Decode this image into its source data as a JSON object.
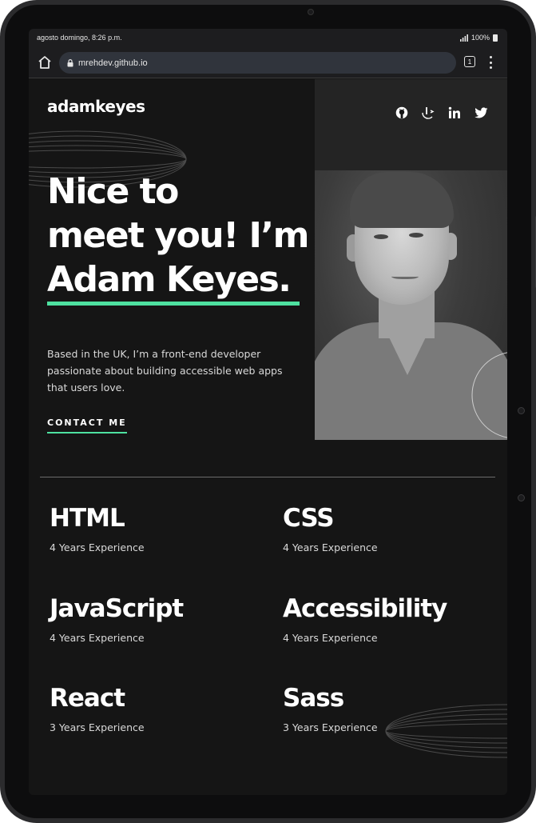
{
  "status_bar": {
    "time": "agosto domingo, 8:26 p.m.",
    "battery": "100%"
  },
  "browser": {
    "url": "mrehdev.github.io",
    "tab_count": "1"
  },
  "site": {
    "logo": "adamkeyes",
    "social_icons": [
      "github-icon",
      "frontend-mentor-icon",
      "linkedin-icon",
      "twitter-icon"
    ],
    "hero": {
      "line1": "Nice to",
      "line2": "meet you! I’m",
      "line3": "Adam Keyes."
    },
    "intro": "Based in the UK, I’m a front-end developer passionate about building accessible web apps that users love.",
    "contact_label": "CONTACT ME",
    "skills": [
      {
        "name": "HTML",
        "experience": "4 Years Experience"
      },
      {
        "name": "CSS",
        "experience": "4 Years Experience"
      },
      {
        "name": "JavaScript",
        "experience": "4 Years Experience"
      },
      {
        "name": "Accessibility",
        "experience": "4 Years Experience"
      },
      {
        "name": "React",
        "experience": "3 Years Experience"
      },
      {
        "name": "Sass",
        "experience": "3 Years Experience"
      }
    ]
  },
  "colors": {
    "accent": "#4ee1a0",
    "background": "#151515",
    "photo_panel": "#242424"
  }
}
